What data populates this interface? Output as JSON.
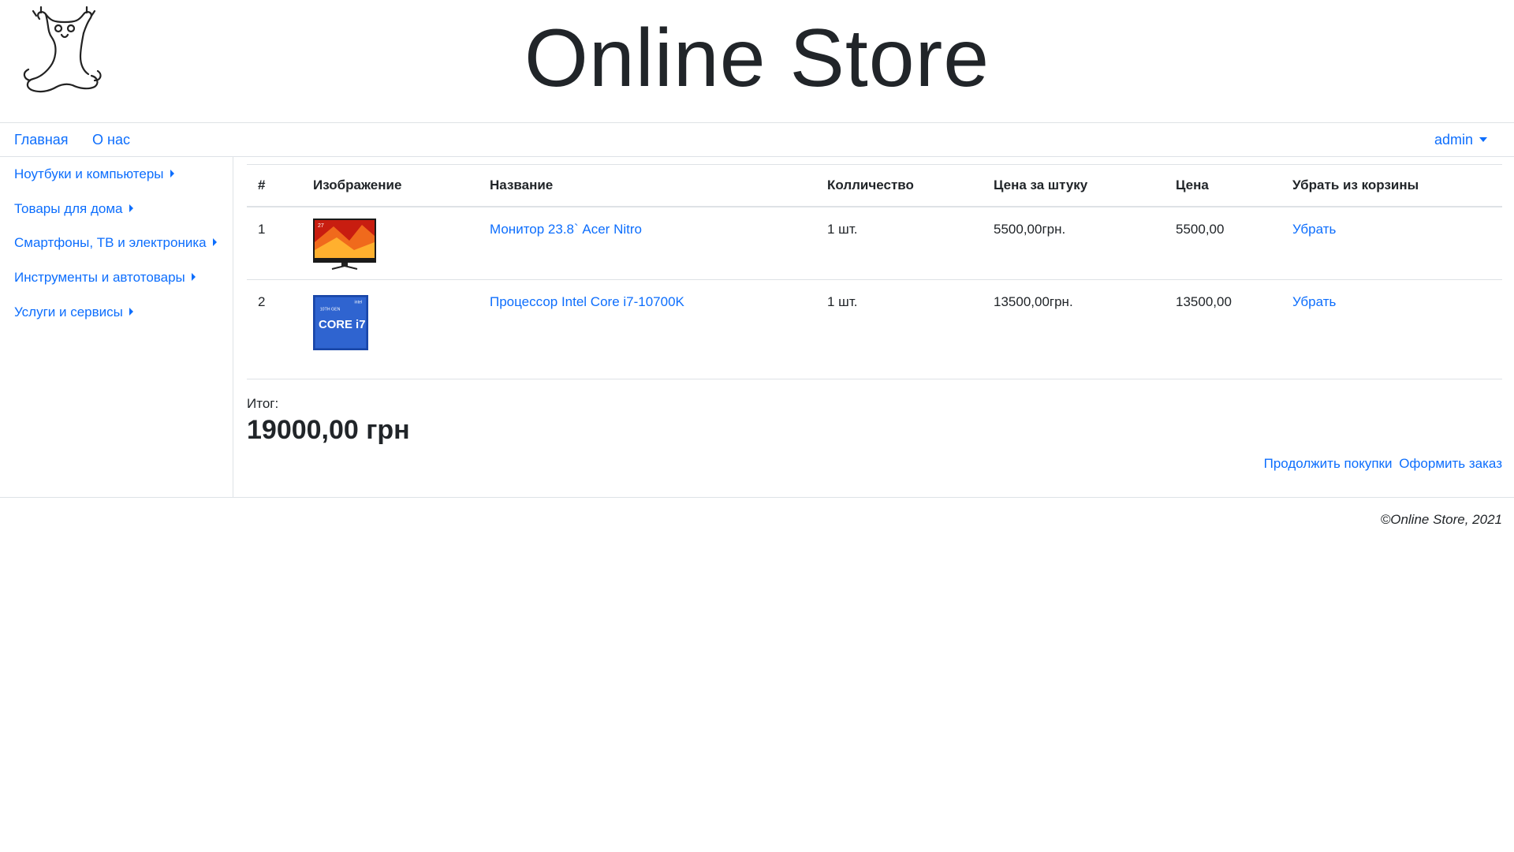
{
  "header": {
    "title": "Online Store"
  },
  "nav": {
    "home": "Главная",
    "about": "О нас",
    "user": "admin"
  },
  "sidebar": {
    "items": [
      {
        "label": "Ноутбуки и компьютеры"
      },
      {
        "label": "Товары для дома"
      },
      {
        "label": "Смартфоны, ТВ и электроника"
      },
      {
        "label": "Инструменты и автотовары"
      },
      {
        "label": "Услуги и сервисы"
      }
    ]
  },
  "cart": {
    "headers": {
      "num": "#",
      "image": "Изображение",
      "name": "Название",
      "qty": "Колличество",
      "unit_price": "Цена за штуку",
      "price": "Цена",
      "remove": "Убрать из корзины"
    },
    "rows": [
      {
        "num": "1",
        "name": "Монитор 23.8` Acer Nitro",
        "qty": "1 шт.",
        "unit_price": "5500,00грн.",
        "price": "5500,00",
        "remove": "Убрать"
      },
      {
        "num": "2",
        "name": "Процессор Intel Core i7-10700K",
        "qty": "1 шт.",
        "unit_price": "13500,00грн.",
        "price": "13500,00",
        "remove": "Убрать"
      }
    ],
    "images": {
      "monitor_text": "27",
      "cpu_text": "CORE i7",
      "cpu_gen": "10TH GEN",
      "cpu_brand": "intel"
    },
    "total_label": "Итог:",
    "total_value": "19000,00 грн",
    "continue_label": "Продолжить покупки",
    "checkout_label": "Оформить заказ"
  },
  "footer": {
    "copyright": "©Online Store, 2021"
  },
  "colors": {
    "link": "#0d6efd",
    "border": "#dee2e6",
    "text": "#212529"
  }
}
